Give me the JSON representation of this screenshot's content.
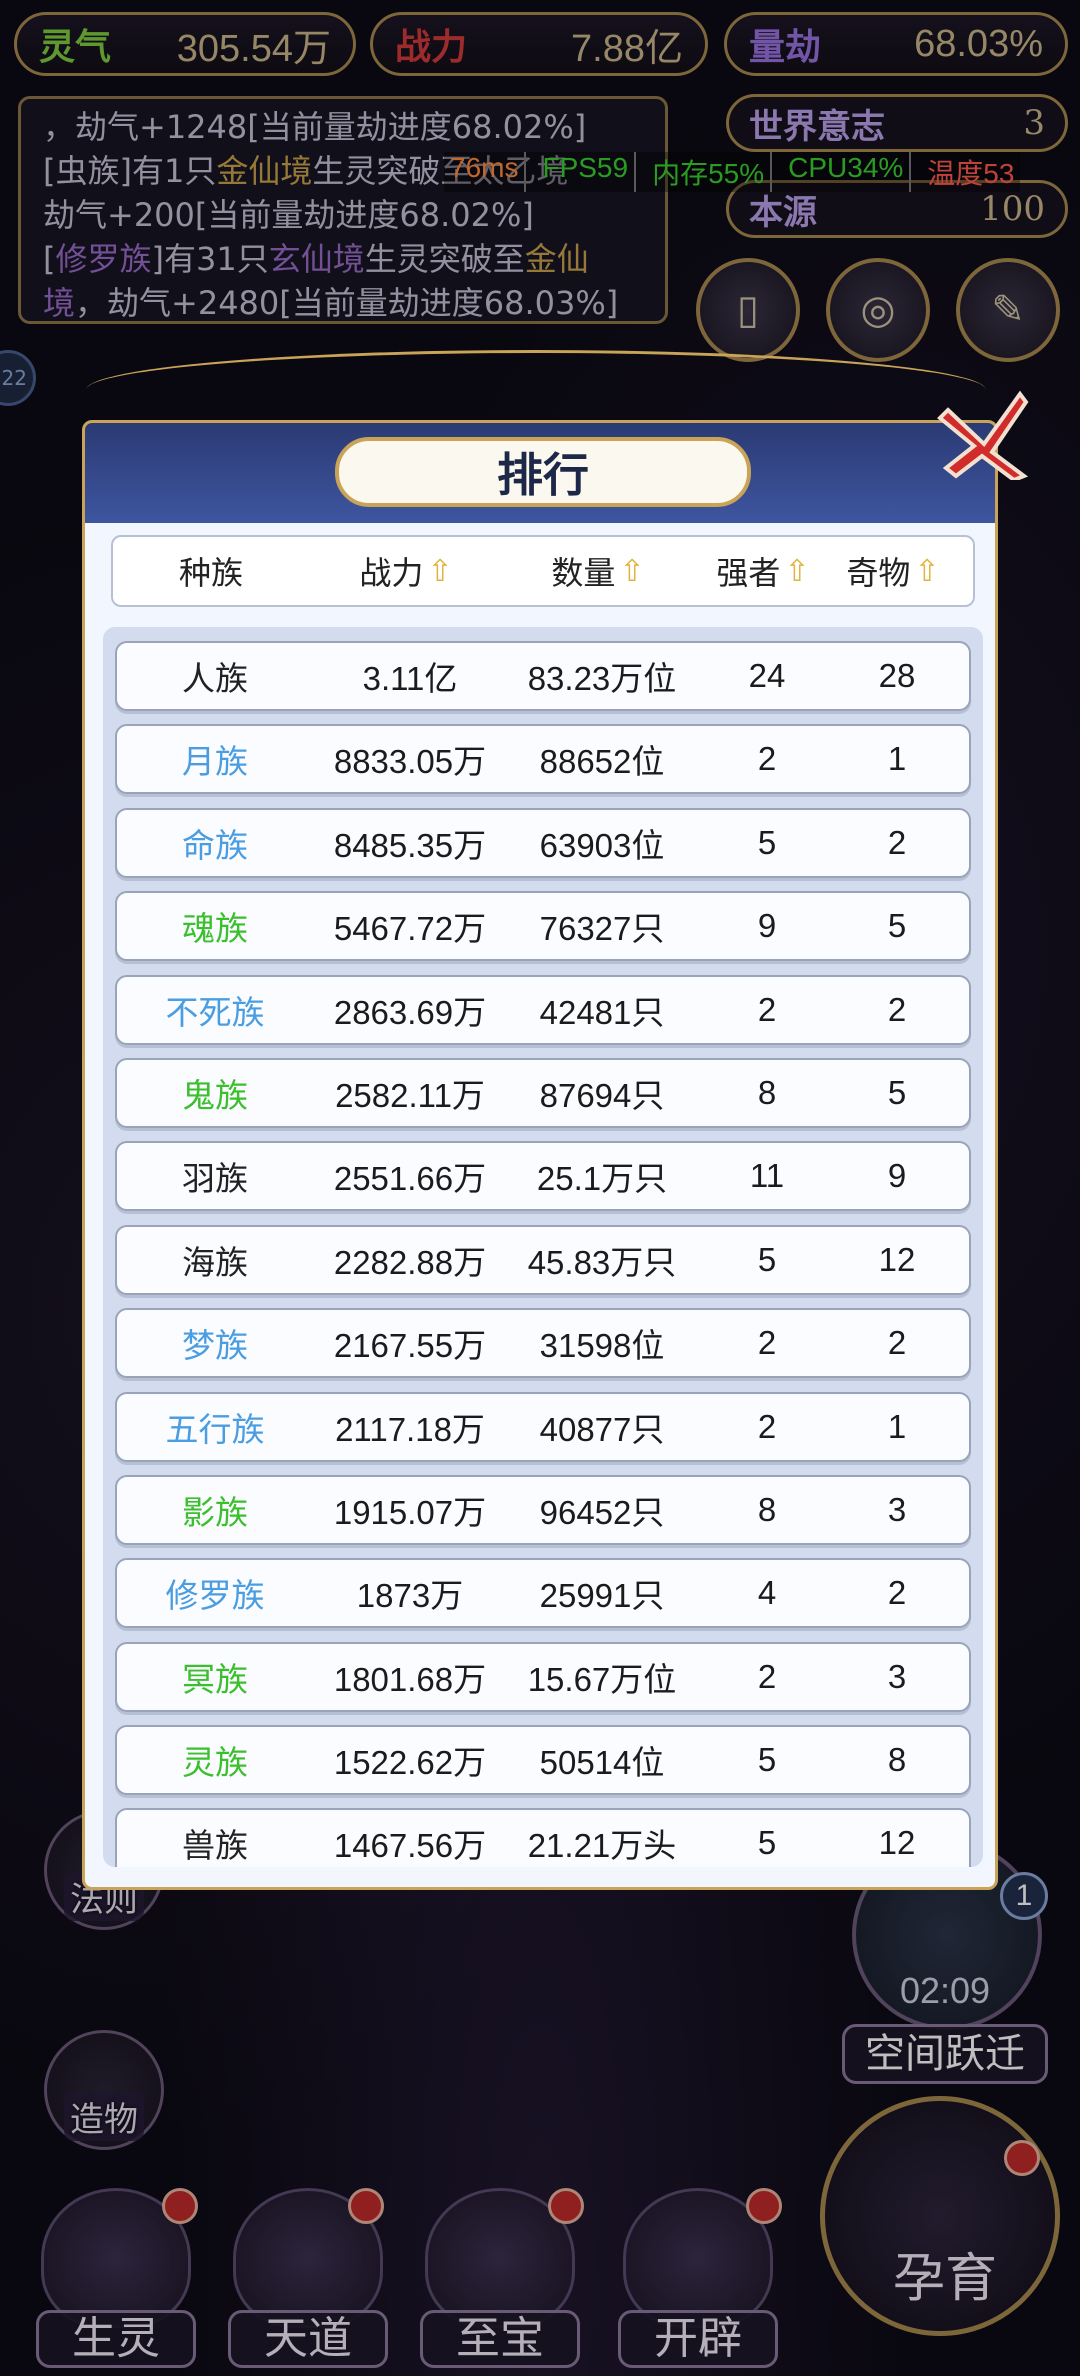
{
  "stats": {
    "lingqi_label": "灵气",
    "lingqi_value": "305.54万",
    "zhanli_label": "战力",
    "zhanli_value": "7.88亿",
    "liangjie_label": "量劫",
    "liangjie_value": "68.03%"
  },
  "world_will": {
    "label": "世界意志",
    "value": "3"
  },
  "origin": {
    "label": "本源",
    "value": "100"
  },
  "log_lines": [
    {
      "pre": "，劫气+1248[当前量劫进度68.02%]"
    },
    {
      "pre": "[虫族]有1只",
      "hl": "金仙境",
      "post": "生灵突破至太乙境"
    },
    {
      "pre": "劫气+200[当前量劫进度68.02%]"
    },
    {
      "pre": "[",
      "hl2": "修罗族",
      "post": "]有31只",
      "hl": "玄仙境",
      "post2": "生灵突破至",
      "hl3": "金仙"
    },
    {
      "pre": "境",
      "post": "，劫气+2480[当前量劫进度68.03%]"
    }
  ],
  "perf": {
    "ping": "76ms",
    "fps": "FPS59",
    "mem": "内存55%",
    "cpu": "CPU34%",
    "temp": "温度53"
  },
  "colors": {
    "gold": "#c9a458",
    "blue_name": "#4a9de0",
    "green_name": "#3bbf2d",
    "black_name": "#222222",
    "perf_ping": "#ff8a3d",
    "perf_green": "#38d12c",
    "perf_red": "#ff5a4d"
  },
  "dialog": {
    "title": "排行",
    "close_icon": "close-x-icon"
  },
  "headers": {
    "race": "种族",
    "power": "战力",
    "count": "数量",
    "strong": "强者",
    "treasure": "奇物"
  },
  "rows": [
    {
      "race": "人族",
      "color": "black",
      "power": "3.11亿",
      "count": "83.23万位",
      "strong": "24",
      "treasure": "28"
    },
    {
      "race": "月族",
      "color": "blue",
      "power": "8833.05万",
      "count": "88652位",
      "strong": "2",
      "treasure": "1"
    },
    {
      "race": "命族",
      "color": "blue",
      "power": "8485.35万",
      "count": "63903位",
      "strong": "5",
      "treasure": "2"
    },
    {
      "race": "魂族",
      "color": "green",
      "power": "5467.72万",
      "count": "76327只",
      "strong": "9",
      "treasure": "5"
    },
    {
      "race": "不死族",
      "color": "blue",
      "power": "2863.69万",
      "count": "42481只",
      "strong": "2",
      "treasure": "2"
    },
    {
      "race": "鬼族",
      "color": "green",
      "power": "2582.11万",
      "count": "87694只",
      "strong": "8",
      "treasure": "5"
    },
    {
      "race": "羽族",
      "color": "black",
      "power": "2551.66万",
      "count": "25.1万只",
      "strong": "11",
      "treasure": "9"
    },
    {
      "race": "海族",
      "color": "black",
      "power": "2282.88万",
      "count": "45.83万只",
      "strong": "5",
      "treasure": "12"
    },
    {
      "race": "梦族",
      "color": "blue",
      "power": "2167.55万",
      "count": "31598位",
      "strong": "2",
      "treasure": "2"
    },
    {
      "race": "五行族",
      "color": "blue",
      "power": "2117.18万",
      "count": "40877只",
      "strong": "2",
      "treasure": "1"
    },
    {
      "race": "影族",
      "color": "green",
      "power": "1915.07万",
      "count": "96452只",
      "strong": "8",
      "treasure": "3"
    },
    {
      "race": "修罗族",
      "color": "blue",
      "power": "1873万",
      "count": "25991只",
      "strong": "4",
      "treasure": "2"
    },
    {
      "race": "冥族",
      "color": "green",
      "power": "1801.68万",
      "count": "15.67万位",
      "strong": "2",
      "treasure": "3"
    },
    {
      "race": "灵族",
      "color": "green",
      "power": "1522.62万",
      "count": "50514位",
      "strong": "5",
      "treasure": "8"
    },
    {
      "race": "兽族",
      "color": "black",
      "power": "1467.56万",
      "count": "21.21万头",
      "strong": "5",
      "treasure": "12"
    }
  ],
  "side": {
    "fa_ze": "法则",
    "zao_wu": "造物"
  },
  "bottom": {
    "sheng_ling": "生灵",
    "tian_dao": "天道",
    "zhi_bao": "至宝",
    "kai_pi": "开辟",
    "yun_yu": "孕育"
  },
  "space": {
    "timer": "02:09",
    "label": "空间跃迁",
    "badge": "1"
  },
  "left_badge": "22"
}
